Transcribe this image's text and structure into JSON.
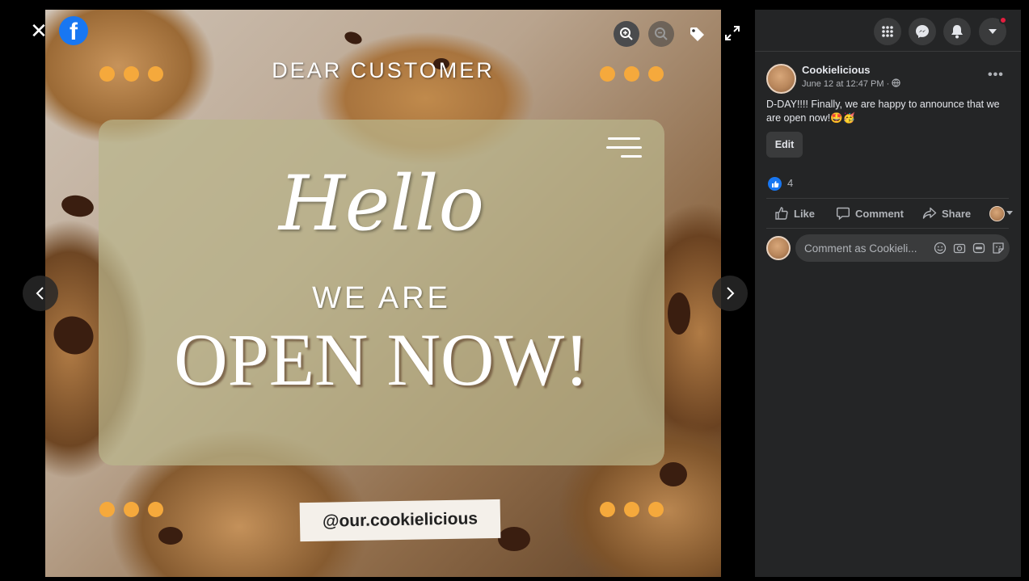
{
  "viewer": {
    "close_symbol": "✕",
    "logo_letter": "f",
    "tools": [
      "zoom-in-icon",
      "zoom-out-icon",
      "tag-icon",
      "fullscreen-icon"
    ],
    "nav": [
      "previous-icon",
      "next-icon"
    ]
  },
  "photo": {
    "heading": "DEAR CUSTOMER",
    "script_text": "Hello",
    "line1": "WE ARE",
    "line2": "OPEN NOW!",
    "handle": "@our.cookielicious",
    "accent_color": "#f5a93c"
  },
  "topbar": {
    "buttons": [
      "menu-grid-icon",
      "messenger-icon",
      "notifications-icon",
      "account-caret-icon"
    ],
    "badge_color": "#e41e3f"
  },
  "post": {
    "author": "Cookielicious",
    "time": "June 12 at 12:47 PM · ",
    "privacy_icon": "globe-icon",
    "more_label": "•••",
    "text": "D-DAY!!!! Finally, we are happy to announce that we are open now!🤩🥳",
    "edit_label": "Edit",
    "like_count": "4",
    "actions": {
      "like": "Like",
      "comment": "Comment",
      "share": "Share"
    },
    "comment_placeholder": "Comment as Cookieli..."
  },
  "colors": {
    "panel_bg": "#242526",
    "facebook_blue": "#1877f2",
    "text_primary": "#e4e6eb",
    "text_secondary": "#b0b3b8"
  }
}
